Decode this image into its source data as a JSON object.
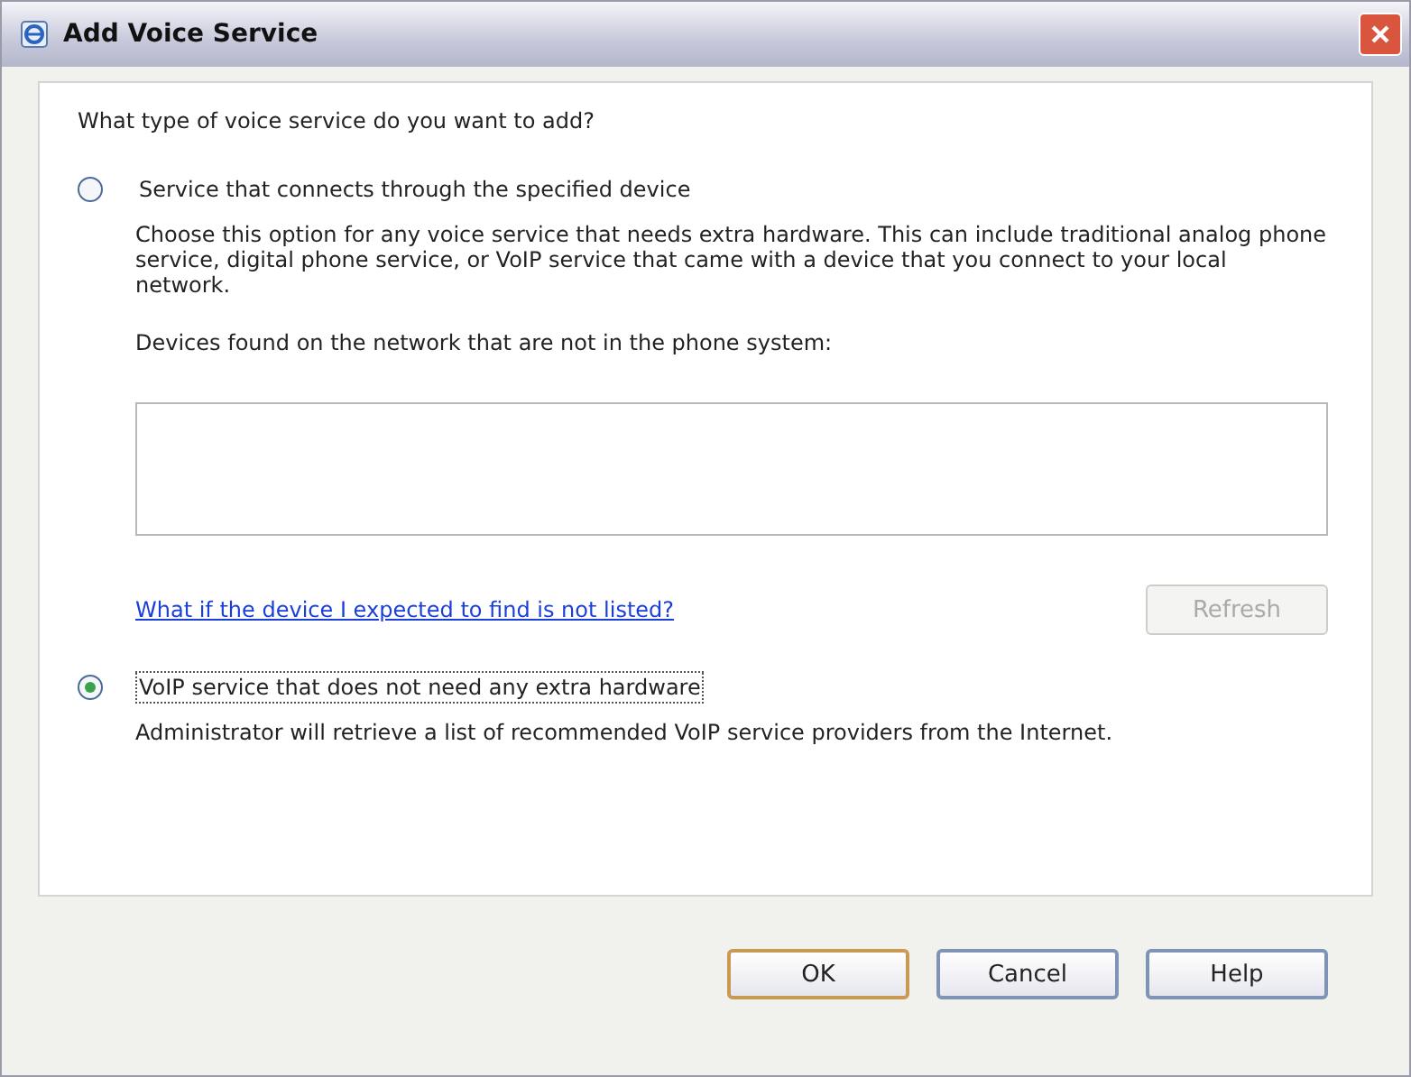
{
  "window": {
    "title": "Add Voice Service"
  },
  "question": "What type of voice service do you want to add?",
  "options": [
    {
      "label": "Service that connects through the specified device",
      "selected": false,
      "description": "Choose this option for any voice service that needs extra hardware. This can include traditional analog phone service, digital phone service, or VoIP service that came with a device that you connect to your local network.",
      "focused": false
    },
    {
      "label": "VoIP service that does not need any extra hardware",
      "selected": true,
      "description": "Administrator will retrieve a list of recommended VoIP service providers from the Internet.",
      "focused": true
    }
  ],
  "devices": {
    "label": "Devices found on the network that are not in the phone system:"
  },
  "help_link": "What if the device I expected to find is not listed?",
  "refresh_button": {
    "label": "Refresh",
    "disabled": true
  },
  "buttons": [
    {
      "label": "OK",
      "default": true
    },
    {
      "label": "Cancel",
      "default": false
    },
    {
      "label": "Help",
      "default": false
    }
  ]
}
